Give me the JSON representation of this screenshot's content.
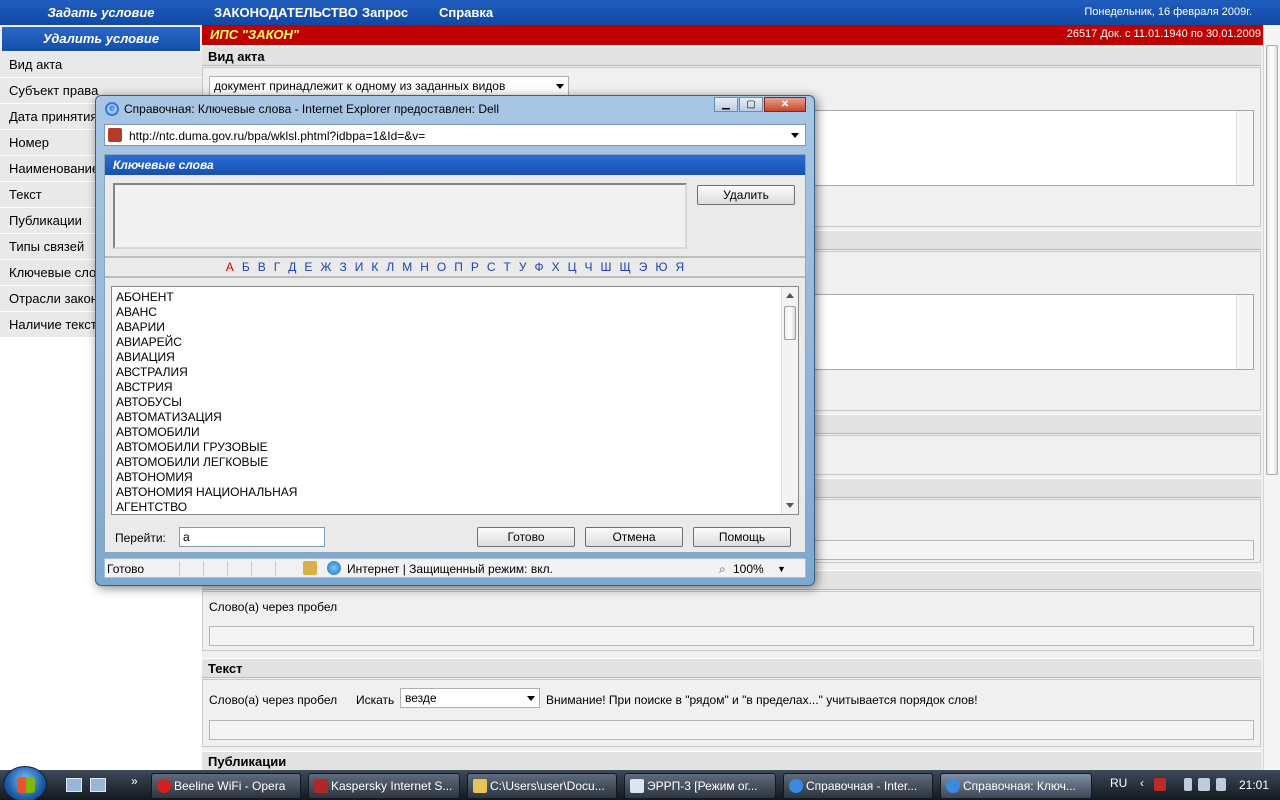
{
  "topbar": {
    "set_condition": "Задать условие",
    "menu": [
      "ЗАКОНОДАТЕЛЬСТВО",
      "Запрос",
      "Справка"
    ],
    "date": "Понедельник, 16 февраля 2009г."
  },
  "leftnav": {
    "delete_condition": "Удалить условие",
    "items": [
      "Вид акта",
      "Субъект права",
      "Дата принятия",
      "Номер",
      "Наименование",
      "Текст",
      "Публикации",
      "Типы связей",
      "Ключевые слова",
      "Отрасли законодательства",
      "Наличие текста"
    ]
  },
  "main": {
    "ips_title": "ИПС \"ЗАКОН\"",
    "doc_count": "26517 Док. с 11.01.1940 по 30.01.2009",
    "section_act_type": "Вид акта",
    "act_type_select": "документ принадлежит к одному из заданных видов",
    "words_label_1": "Слово(а) через пробел",
    "section_text": "Текст",
    "words_label_2": "Слово(а) через пробел",
    "search_label": "Искать",
    "search_where": "везде",
    "warning": "Внимание! При поиске в \"рядом\" и \"в пределах...\" учитывается порядок слов!",
    "section_publications": "Публикации"
  },
  "dialog": {
    "title": "Справочная: Ключевые слова - Internet Explorer предоставлен: Dell",
    "url": "http://ntc.duma.gov.ru/bpa/wklsl.phtml?idbpa=1&Id=&v=",
    "header": "Ключевые слова",
    "delete_btn": "Удалить",
    "alphabet": [
      "А",
      "Б",
      "В",
      "Г",
      "Д",
      "Е",
      "Ж",
      "З",
      "И",
      "К",
      "Л",
      "М",
      "Н",
      "О",
      "П",
      "Р",
      "С",
      "Т",
      "У",
      "Ф",
      "Х",
      "Ц",
      "Ч",
      "Ш",
      "Щ",
      "Э",
      "Ю",
      "Я"
    ],
    "active_letter": "А",
    "keywords": [
      "АБОНЕНТ",
      "АВАНС",
      "АВАРИИ",
      "АВИАРЕЙС",
      "АВИАЦИЯ",
      "АВСТРАЛИЯ",
      "АВСТРИЯ",
      "АВТОБУСЫ",
      "АВТОМАТИЗАЦИЯ",
      "АВТОМОБИЛИ",
      "АВТОМОБИЛИ ГРУЗОВЫЕ",
      "АВТОМОБИЛИ ЛЕГКОВЫЕ",
      "АВТОНОМИЯ",
      "АВТОНОМИЯ НАЦИОНАЛЬНАЯ",
      "АГЕНТСТВО"
    ],
    "goto_label": "Перейти:",
    "goto_value": "а",
    "ok_btn": "Готово",
    "cancel_btn": "Отмена",
    "help_btn": "Помощь",
    "status_ready": "Готово",
    "status_zone": "Интернет | Защищенный режим: вкл.",
    "zoom": "100%"
  },
  "taskbar": {
    "tasks": [
      "Beeline WiFi - Opera",
      "Kaspersky Internet S...",
      "C:\\Users\\user\\Docu...",
      "ЭРРП-3 [Режим ог...",
      "Справочная - Inter...",
      "Справочная: Ключ..."
    ],
    "lang": "RU",
    "time": "21:01"
  }
}
